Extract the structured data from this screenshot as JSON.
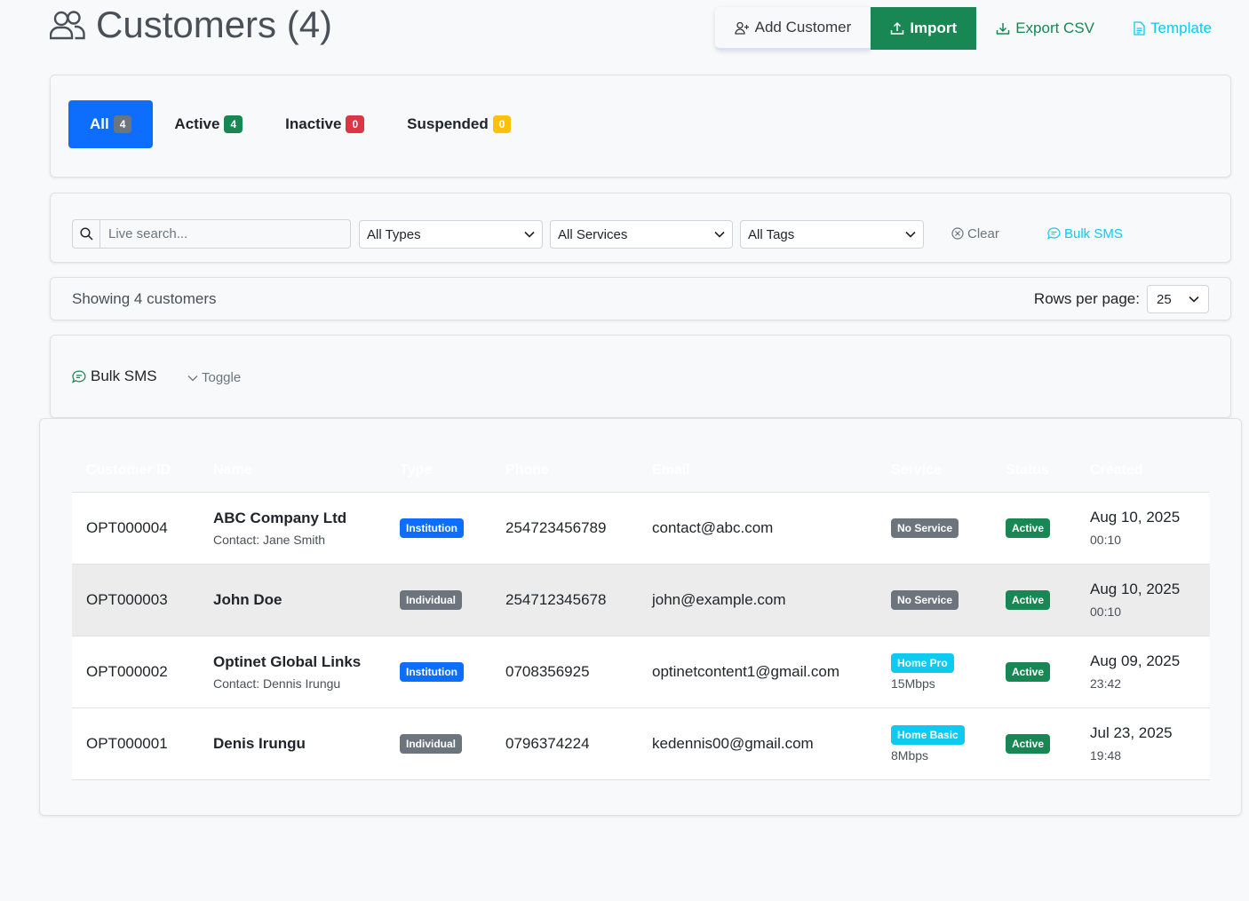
{
  "header": {
    "title": "Customers (4)",
    "add_label": "Add Customer",
    "import_label": "Import",
    "export_label": "Export CSV",
    "template_label": "Template"
  },
  "tabs": [
    {
      "label": "All",
      "count": "4"
    },
    {
      "label": "Active",
      "count": "4"
    },
    {
      "label": "Inactive",
      "count": "0"
    },
    {
      "label": "Suspended",
      "count": "0"
    }
  ],
  "filters": {
    "search_placeholder": "Live search...",
    "types": "All Types",
    "services": "All Services",
    "tags": "All Tags",
    "clear_label": "Clear",
    "bulk_sms_label": "Bulk SMS"
  },
  "summary": {
    "showing": "Showing 4 customers",
    "rows_label": "Rows per page:",
    "rows_value": "25"
  },
  "sms_panel": {
    "title": "Bulk SMS",
    "toggle_label": "Toggle"
  },
  "table": {
    "columns": [
      "Customer ID",
      "Name",
      "Type",
      "Phone",
      "Email",
      "Service",
      "Status",
      "Created"
    ],
    "rows": [
      {
        "id": "OPT000004",
        "name": "ABC Company Ltd",
        "contact": "Contact: Jane Smith",
        "type": "Institution",
        "phone": "254723456789",
        "email": "contact@abc.com",
        "service": "No Service",
        "speed": "",
        "status": "Active",
        "date": "Aug 10, 2025",
        "time": "00:10"
      },
      {
        "id": "OPT000003",
        "name": "John Doe",
        "contact": "",
        "type": "Individual",
        "phone": "254712345678",
        "email": "john@example.com",
        "service": "No Service",
        "speed": "",
        "status": "Active",
        "date": "Aug 10, 2025",
        "time": "00:10"
      },
      {
        "id": "OPT000002",
        "name": "Optinet Global Links",
        "contact": "Contact: Dennis Irungu",
        "type": "Institution",
        "phone": "0708356925",
        "email": "optinetcontent1@gmail.com",
        "service": "Home Pro",
        "speed": "15Mbps",
        "status": "Active",
        "date": "Aug 09, 2025",
        "time": "23:42"
      },
      {
        "id": "OPT000001",
        "name": "Denis Irungu",
        "contact": "",
        "type": "Individual",
        "phone": "0796374224",
        "email": "kedennis00@gmail.com",
        "service": "Home Basic",
        "speed": "8Mbps",
        "status": "Active",
        "date": "Jul 23, 2025",
        "time": "19:48"
      }
    ]
  }
}
